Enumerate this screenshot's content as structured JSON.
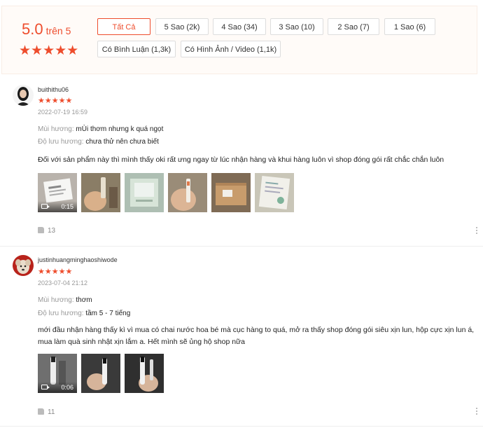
{
  "summary": {
    "score": "5.0",
    "out_of": "trên 5",
    "stars": "★★★★★",
    "rating_fraction": 1.0,
    "filters": [
      {
        "label": "Tất Cả",
        "active": true
      },
      {
        "label": "5 Sao (2k)",
        "active": false
      },
      {
        "label": "4 Sao (34)",
        "active": false
      },
      {
        "label": "3 Sao (10)",
        "active": false
      },
      {
        "label": "2 Sao (7)",
        "active": false
      },
      {
        "label": "1 Sao (6)",
        "active": false
      },
      {
        "label": "Có Bình Luận (1,3k)",
        "active": false
      },
      {
        "label": "Có Hình Ảnh / Video (1,1k)",
        "active": false
      }
    ]
  },
  "colors": {
    "accent": "#ee4d2d"
  },
  "reviews": [
    {
      "username": "buithithu06",
      "stars": "★★★★★",
      "date": "2022-07-19 16:59",
      "attr1_label": "Mùi hương:",
      "attr1_value": "mÙi thơm nhưng k quá ngọt",
      "attr2_label": "Độ lưu hương:",
      "attr2_value": "chưa thử nên chưa biết",
      "text": "Đối với sản phẩm này thì mình thấy oki rất ưng ngay từ lúc nhận hàng và khui hàng luôn vì shop đóng gói rất chắc chắn luôn",
      "video_duration": "0:15",
      "likes": "13"
    },
    {
      "username": "justinhuangminghaoshiwode",
      "stars": "★★★★★",
      "date": "2023-07-04 21:12",
      "attr1_label": "Mùi hương:",
      "attr1_value": "thơm",
      "attr2_label": "Độ lưu hương:",
      "attr2_value": "tầm 5 - 7 tiếng",
      "text": "mới đầu nhận hàng thấy kì vì mua có chai nước hoa bé mà cục hàng to quá, mở ra thấy shop đóng gói siêu xịn lun, hộp cực xịn lun á, mua làm quà sinh nhật xịn lắm a. Hết mình sẽ ủng hộ shop nữa",
      "video_duration": "0:06",
      "likes": "11"
    }
  ]
}
